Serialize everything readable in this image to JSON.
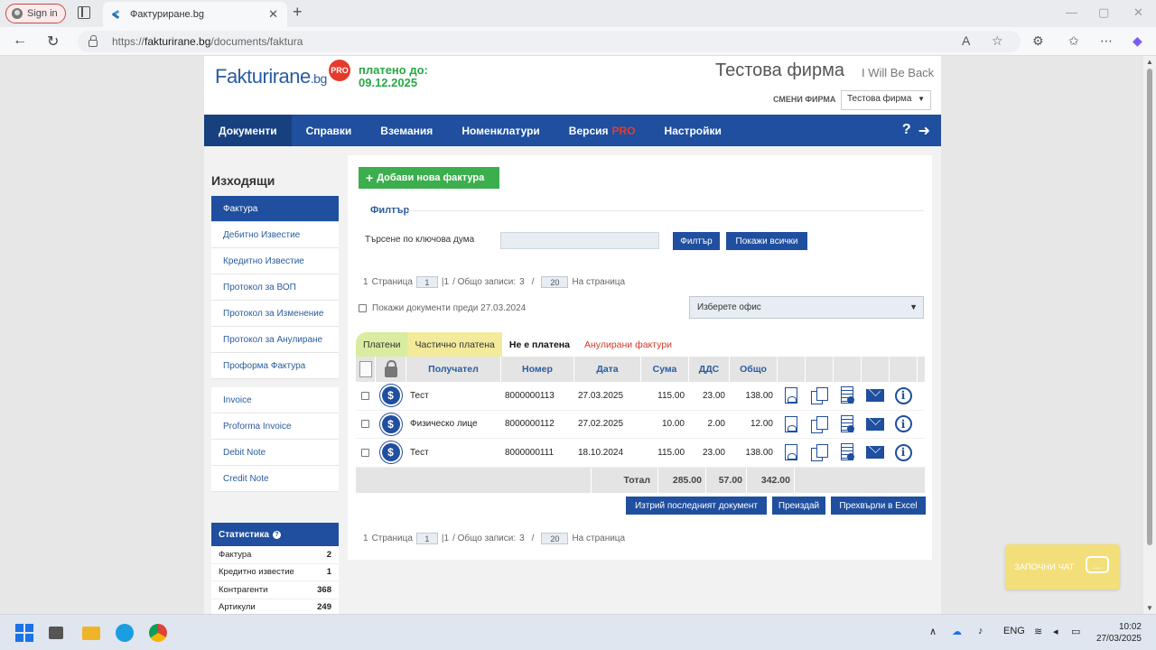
{
  "browser": {
    "signin_label": "Sign in",
    "tab_title": "Фактуриране.bg",
    "url_prefix": "https://",
    "url_host": "fakturirane.bg",
    "url_path": "/documents/faktura"
  },
  "header": {
    "logo_main": "Fakturirane",
    "logo_tld": ".bg",
    "pro_badge": "PRO",
    "paid_until_label": "платено до:",
    "paid_until_date": "09.12.2025",
    "company_name": "Тестова фирма",
    "company_tagline": "I Will Be Back",
    "switch_company_label": "СМЕНИ ФИРМА",
    "company_select_value": "Тестова фирма"
  },
  "nav": {
    "items": [
      {
        "label": "Документи"
      },
      {
        "label": "Справки"
      },
      {
        "label": "Вземания"
      },
      {
        "label": "Номенклатури"
      },
      {
        "label": "Версия",
        "suffix": "PRO"
      },
      {
        "label": "Настройки"
      }
    ],
    "help_glyph": "?",
    "logout_glyph": "➜"
  },
  "sidebar": {
    "title": "Изходящи",
    "items": [
      "Фактура",
      "Дебитно Известие",
      "Кредитно Известие",
      "Протокол за ВОП",
      "Протокол за Изменение",
      "Протокол за Анулиране",
      "Проформа Фактура"
    ],
    "items_en": [
      "Invoice",
      "Proforma Invoice",
      "Debit Note",
      "Credit Note"
    ],
    "stats_title": "Статистика",
    "stats": [
      {
        "label": "Фактура",
        "value": "2"
      },
      {
        "label": "Кредитно известие",
        "value": "1"
      },
      {
        "label": "Контрагенти",
        "value": "368"
      },
      {
        "label": "Артикули",
        "value": "249"
      }
    ]
  },
  "content": {
    "add_button": "Добави нова фактура",
    "filter_title": "Филтър",
    "keyword_label": "Търсене по ключова дума",
    "keyword_value": "",
    "filter_button": "Филтър",
    "show_all_button": "Покажи всички",
    "pager": {
      "page_prefix": "1",
      "page_label": "Страница",
      "page_value": "1",
      "pages_total": "|1",
      "records_label": "/ Общо записи:",
      "records_total": "3",
      "sep": "/",
      "per_page_value": "20",
      "per_page_label": "На страница"
    },
    "show_before_label": "Покажи документи преди 27.03.2024",
    "office_select_placeholder": "Изберете офис",
    "tabs": [
      "Платени",
      "Частично платена",
      "Не е платена",
      "Анулирани фактури"
    ],
    "columns": {
      "recipient": "Получател",
      "number": "Номер",
      "date": "Дата",
      "sum": "Сума",
      "vat": "ДДС",
      "total": "Общо"
    },
    "rows": [
      {
        "recipient": "Тест",
        "number": "8000000113",
        "date": "27.03.2025",
        "sum": "115.00",
        "vat": "23.00",
        "total": "138.00"
      },
      {
        "recipient": "Физическо лице",
        "number": "8000000112",
        "date": "27.02.2025",
        "sum": "10.00",
        "vat": "2.00",
        "total": "12.00"
      },
      {
        "recipient": "Тест",
        "number": "8000000111",
        "date": "18.10.2024",
        "sum": "115.00",
        "vat": "23.00",
        "total": "138.00"
      }
    ],
    "totals": {
      "label": "Тотал",
      "sum": "285.00",
      "vat": "57.00",
      "total": "342.00"
    },
    "delete_last_button": "Изтрий последният документ",
    "reissue_button": "Преиздай",
    "excel_button": "Прехвърли в Excel"
  },
  "chat": {
    "label": "ЗАПОЧНИ ЧАТ",
    "glyph": "..."
  },
  "taskbar": {
    "lang": "ENG",
    "time": "10:02",
    "date": "27/03/2025"
  },
  "colors": {
    "brand_blue": "#1f4f9e",
    "green": "#3cae4d",
    "pro_red": "#e53b2b"
  }
}
